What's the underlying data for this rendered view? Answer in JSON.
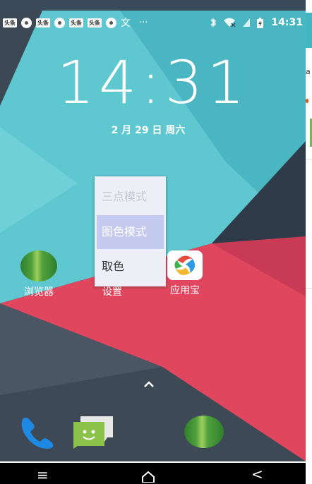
{
  "statusbar": {
    "news_label": "头条",
    "char_icon": "文",
    "dots": "···",
    "time": "14:31"
  },
  "lockscreen": {
    "time": "14:31",
    "date": "2 月 29 日 周六"
  },
  "apps": [
    {
      "label": "浏览器",
      "icon": "watermelon-browser-icon"
    },
    {
      "label": "设置",
      "icon": "settings-icon"
    },
    {
      "label": "应用宝",
      "icon": "yingyongbao-icon"
    }
  ],
  "popup_menu": {
    "items": [
      {
        "label": "三点模式",
        "state": "faded"
      },
      {
        "label": "图色模式",
        "state": "selected"
      },
      {
        "label": "取色",
        "state": "normal"
      }
    ]
  },
  "dock": [
    {
      "icon": "phone-icon"
    },
    {
      "icon": "messages-icon"
    },
    {
      "icon": "watermelon-browser-icon"
    }
  ],
  "navbar": {
    "menu_glyph": "≡",
    "back_glyph": "<"
  },
  "side_strip": {
    "text": "a"
  },
  "colors": {
    "teal": "#5ec7d0",
    "red": "#e0475e",
    "dark": "#34414f",
    "menu_bg": "#eeeef6",
    "menu_selected": "#c5cbf0"
  }
}
